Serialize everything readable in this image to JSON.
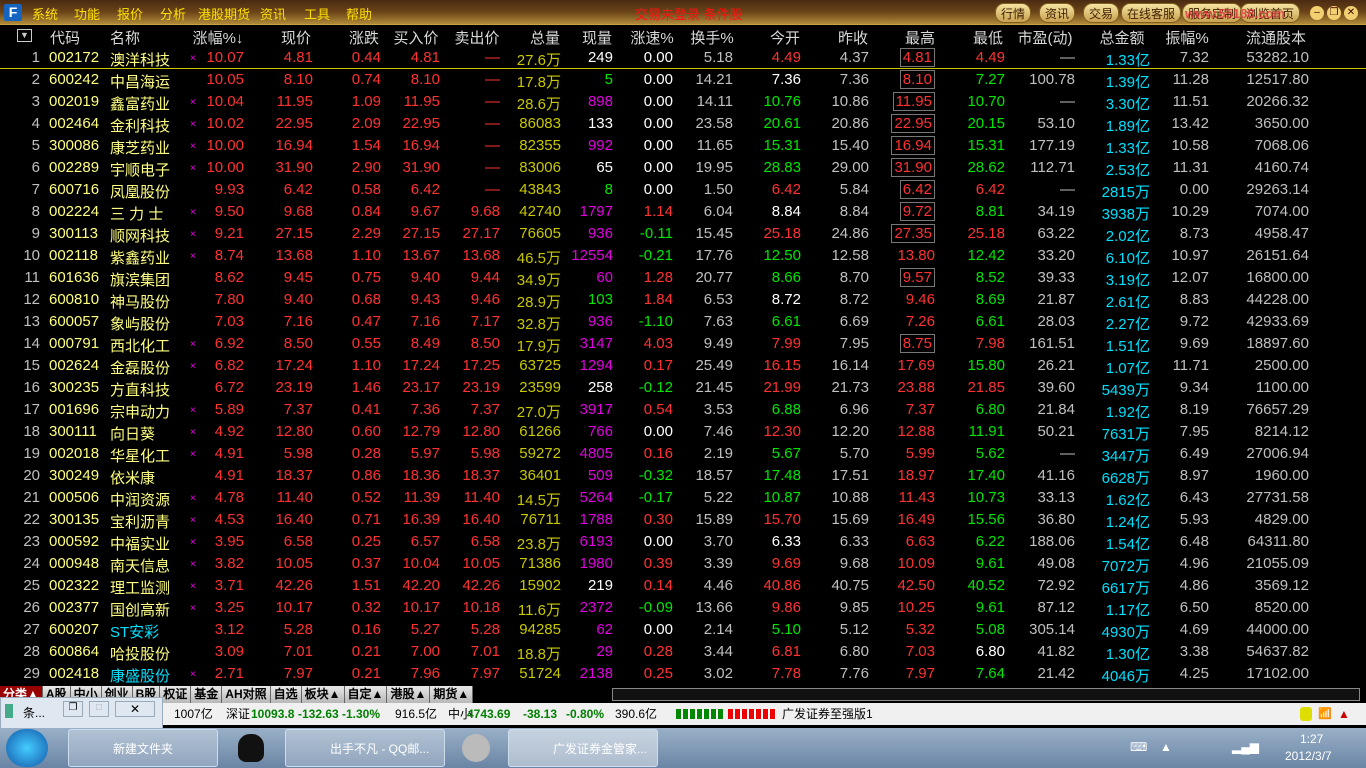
{
  "menubar": {
    "logo": "F",
    "items": [
      "系统",
      "功能",
      "报价",
      "分析",
      "港股期货",
      "资讯",
      "工具",
      "帮助"
    ],
    "title": "交易未登录 条件股",
    "buttons": [
      "行情",
      "资讯",
      "交易",
      "在线客服",
      "服务定制",
      "浏览首页"
    ],
    "watermark": "www.55188.com"
  },
  "header": {
    "sort_icon": "▼",
    "columns": [
      "代码",
      "名称",
      "涨幅%↓",
      "现价",
      "涨跌",
      "买入价",
      "卖出价",
      "总量",
      "现量",
      "涨速%",
      "换手%",
      "今开",
      "昨收",
      "最高",
      "最低",
      "市盈(动)",
      "总金额",
      "振幅%",
      "流通股本"
    ]
  },
  "colors": {
    "up": "#ff3232",
    "down": "#00e600",
    "volume": "#c8c800",
    "amount": "#00e0ff",
    "code": "#ffff80",
    "sell_tick": "#e000e0"
  },
  "rows": [
    {
      "v": [
        "1",
        "002172",
        "澳洋科技",
        "×",
        "10.07",
        "4.81",
        "0.44",
        "4.81",
        "—",
        "27.6万",
        "249",
        "0.00",
        "5.18",
        "4.49",
        "4.37",
        "4.81",
        "4.49",
        "—",
        "1.33亿",
        "7.32",
        "53282.10"
      ],
      "cur": "w",
      "box": true
    },
    {
      "v": [
        "2",
        "600242",
        "中昌海运",
        "",
        "10.05",
        "8.10",
        "0.74",
        "8.10",
        "—",
        "17.8万",
        "5",
        "0.00",
        "14.21",
        "7.36",
        "7.36",
        "8.10",
        "7.27",
        "100.78",
        "1.39亿",
        "11.28",
        "12517.80"
      ],
      "cur": "g",
      "box": true
    },
    {
      "v": [
        "3",
        "002019",
        "鑫富药业",
        "×",
        "10.04",
        "11.95",
        "1.09",
        "11.95",
        "—",
        "28.6万",
        "898",
        "0.00",
        "14.11",
        "10.76",
        "10.86",
        "11.95",
        "10.70",
        "—",
        "3.30亿",
        "11.51",
        "20266.32"
      ],
      "cur": "m",
      "box": true
    },
    {
      "v": [
        "4",
        "002464",
        "金利科技",
        "×",
        "10.02",
        "22.95",
        "2.09",
        "22.95",
        "—",
        "86083",
        "133",
        "0.00",
        "23.58",
        "20.61",
        "20.86",
        "22.95",
        "20.15",
        "53.10",
        "1.89亿",
        "13.42",
        "3650.00"
      ],
      "cur": "w",
      "box": true
    },
    {
      "v": [
        "5",
        "300086",
        "康芝药业",
        "×",
        "10.00",
        "16.94",
        "1.54",
        "16.94",
        "—",
        "82355",
        "992",
        "0.00",
        "11.65",
        "15.31",
        "15.40",
        "16.94",
        "15.31",
        "177.19",
        "1.33亿",
        "10.58",
        "7068.06"
      ],
      "cur": "m",
      "box": true
    },
    {
      "v": [
        "6",
        "002289",
        "宇顺电子",
        "×",
        "10.00",
        "31.90",
        "2.90",
        "31.90",
        "—",
        "83006",
        "65",
        "0.00",
        "19.95",
        "28.83",
        "29.00",
        "31.90",
        "28.62",
        "112.71",
        "2.53亿",
        "11.31",
        "4160.74"
      ],
      "cur": "w",
      "box": true
    },
    {
      "v": [
        "7",
        "600716",
        "凤凰股份",
        "",
        "9.93",
        "6.42",
        "0.58",
        "6.42",
        "—",
        "43843",
        "8",
        "0.00",
        "1.50",
        "6.42",
        "5.84",
        "6.42",
        "6.42",
        "—",
        "2815万",
        "0.00",
        "29263.14"
      ],
      "cur": "g",
      "box": true
    },
    {
      "v": [
        "8",
        "002224",
        "三 力 士",
        "×",
        "9.50",
        "9.68",
        "0.84",
        "9.67",
        "9.68",
        "42740",
        "1797",
        "1.14",
        "6.04",
        "8.84",
        "8.84",
        "9.72",
        "8.81",
        "34.19",
        "3938万",
        "10.29",
        "7074.00"
      ],
      "cur": "m",
      "box": true
    },
    {
      "v": [
        "9",
        "300113",
        "顺网科技",
        "×",
        "9.21",
        "27.15",
        "2.29",
        "27.15",
        "27.17",
        "76605",
        "936",
        "-0.11",
        "15.45",
        "25.18",
        "24.86",
        "27.35",
        "25.18",
        "63.22",
        "2.02亿",
        "8.73",
        "4958.47"
      ],
      "cur": "m",
      "box": true
    },
    {
      "v": [
        "10",
        "002118",
        "紫鑫药业",
        "×",
        "8.74",
        "13.68",
        "1.10",
        "13.67",
        "13.68",
        "46.5万",
        "12554",
        "-0.21",
        "17.76",
        "12.50",
        "12.58",
        "13.80",
        "12.42",
        "33.20",
        "6.10亿",
        "10.97",
        "26151.64"
      ],
      "cur": "m",
      "box": false
    },
    {
      "v": [
        "11",
        "601636",
        "旗滨集团",
        "",
        "8.62",
        "9.45",
        "0.75",
        "9.40",
        "9.44",
        "34.9万",
        "60",
        "1.28",
        "20.77",
        "8.66",
        "8.70",
        "9.57",
        "8.52",
        "39.33",
        "3.19亿",
        "12.07",
        "16800.00"
      ],
      "cur": "m",
      "box": true
    },
    {
      "v": [
        "12",
        "600810",
        "神马股份",
        "",
        "7.80",
        "9.40",
        "0.68",
        "9.43",
        "9.46",
        "28.9万",
        "103",
        "1.84",
        "6.53",
        "8.72",
        "8.72",
        "9.46",
        "8.69",
        "21.87",
        "2.61亿",
        "8.83",
        "44228.00"
      ],
      "cur": "g",
      "box": false
    },
    {
      "v": [
        "13",
        "600057",
        "象屿股份",
        "",
        "7.03",
        "7.16",
        "0.47",
        "7.16",
        "7.17",
        "32.8万",
        "936",
        "-1.10",
        "7.63",
        "6.61",
        "6.69",
        "7.26",
        "6.61",
        "28.03",
        "2.27亿",
        "9.72",
        "42933.69"
      ],
      "cur": "m",
      "box": false
    },
    {
      "v": [
        "14",
        "000791",
        "西北化工",
        "×",
        "6.92",
        "8.50",
        "0.55",
        "8.49",
        "8.50",
        "17.9万",
        "3147",
        "4.03",
        "9.49",
        "7.99",
        "7.95",
        "8.75",
        "7.98",
        "161.51",
        "1.51亿",
        "9.69",
        "18897.60"
      ],
      "cur": "m",
      "box": true
    },
    {
      "v": [
        "15",
        "002624",
        "金磊股份",
        "×",
        "6.82",
        "17.24",
        "1.10",
        "17.24",
        "17.25",
        "63725",
        "1294",
        "0.17",
        "25.49",
        "16.15",
        "16.14",
        "17.69",
        "15.80",
        "26.21",
        "1.07亿",
        "11.71",
        "2500.00"
      ],
      "cur": "m",
      "box": false
    },
    {
      "v": [
        "16",
        "300235",
        "方直科技",
        "",
        "6.72",
        "23.19",
        "1.46",
        "23.17",
        "23.19",
        "23599",
        "258",
        "-0.12",
        "21.45",
        "21.99",
        "21.73",
        "23.88",
        "21.85",
        "39.60",
        "5439万",
        "9.34",
        "1100.00"
      ],
      "cur": "w",
      "box": false
    },
    {
      "v": [
        "17",
        "001696",
        "宗申动力",
        "×",
        "5.89",
        "7.37",
        "0.41",
        "7.36",
        "7.37",
        "27.0万",
        "3917",
        "0.54",
        "3.53",
        "6.88",
        "6.96",
        "7.37",
        "6.80",
        "21.84",
        "1.92亿",
        "8.19",
        "76657.29"
      ],
      "cur": "m",
      "box": false
    },
    {
      "v": [
        "18",
        "300111",
        "向日葵",
        "×",
        "4.92",
        "12.80",
        "0.60",
        "12.79",
        "12.80",
        "61266",
        "766",
        "0.00",
        "7.46",
        "12.30",
        "12.20",
        "12.88",
        "11.91",
        "50.21",
        "7631万",
        "7.95",
        "8214.12"
      ],
      "cur": "m",
      "box": false
    },
    {
      "v": [
        "19",
        "002018",
        "华星化工",
        "×",
        "4.91",
        "5.98",
        "0.28",
        "5.97",
        "5.98",
        "59272",
        "4805",
        "0.16",
        "2.19",
        "5.67",
        "5.70",
        "5.99",
        "5.62",
        "—",
        "3447万",
        "6.49",
        "27006.94"
      ],
      "cur": "m",
      "box": false
    },
    {
      "v": [
        "20",
        "300249",
        "依米康",
        "",
        "4.91",
        "18.37",
        "0.86",
        "18.36",
        "18.37",
        "36401",
        "509",
        "-0.32",
        "18.57",
        "17.48",
        "17.51",
        "18.97",
        "17.40",
        "41.16",
        "6628万",
        "8.97",
        "1960.00"
      ],
      "cur": "m",
      "box": false
    },
    {
      "v": [
        "21",
        "000506",
        "中润资源",
        "×",
        "4.78",
        "11.40",
        "0.52",
        "11.39",
        "11.40",
        "14.5万",
        "5264",
        "-0.17",
        "5.22",
        "10.87",
        "10.88",
        "11.43",
        "10.73",
        "33.13",
        "1.62亿",
        "6.43",
        "27731.58"
      ],
      "cur": "m",
      "box": false
    },
    {
      "v": [
        "22",
        "300135",
        "宝利沥青",
        "×",
        "4.53",
        "16.40",
        "0.71",
        "16.39",
        "16.40",
        "76711",
        "1788",
        "0.30",
        "15.89",
        "15.70",
        "15.69",
        "16.49",
        "15.56",
        "36.80",
        "1.24亿",
        "5.93",
        "4829.00"
      ],
      "cur": "m",
      "box": false
    },
    {
      "v": [
        "23",
        "000592",
        "中福实业",
        "×",
        "3.95",
        "6.58",
        "0.25",
        "6.57",
        "6.58",
        "23.8万",
        "6193",
        "0.00",
        "3.70",
        "6.33",
        "6.33",
        "6.63",
        "6.22",
        "188.06",
        "1.54亿",
        "6.48",
        "64311.80"
      ],
      "cur": "m",
      "box": false
    },
    {
      "v": [
        "24",
        "000948",
        "南天信息",
        "×",
        "3.82",
        "10.05",
        "0.37",
        "10.04",
        "10.05",
        "71386",
        "1980",
        "0.39",
        "3.39",
        "9.69",
        "9.68",
        "10.09",
        "9.61",
        "49.08",
        "7072万",
        "4.96",
        "21055.09"
      ],
      "cur": "m",
      "box": false
    },
    {
      "v": [
        "25",
        "002322",
        "理工监测",
        "×",
        "3.71",
        "42.26",
        "1.51",
        "42.20",
        "42.26",
        "15902",
        "219",
        "0.14",
        "4.46",
        "40.86",
        "40.75",
        "42.50",
        "40.52",
        "72.92",
        "6617万",
        "4.86",
        "3569.12"
      ],
      "cur": "w",
      "box": false
    },
    {
      "v": [
        "26",
        "002377",
        "国创高新",
        "×",
        "3.25",
        "10.17",
        "0.32",
        "10.17",
        "10.18",
        "11.6万",
        "2372",
        "-0.09",
        "13.66",
        "9.86",
        "9.85",
        "10.25",
        "9.61",
        "87.12",
        "1.17亿",
        "6.50",
        "8520.00"
      ],
      "cur": "m",
      "box": false
    },
    {
      "v": [
        "27",
        "600207",
        "ST安彩",
        "",
        "3.12",
        "5.28",
        "0.16",
        "5.27",
        "5.28",
        "94285",
        "62",
        "0.00",
        "2.14",
        "5.10",
        "5.12",
        "5.32",
        "5.08",
        "305.14",
        "4930万",
        "4.69",
        "44000.00"
      ],
      "cur": "m",
      "box": false,
      "name_color": "cy"
    },
    {
      "v": [
        "28",
        "600864",
        "哈投股份",
        "",
        "3.09",
        "7.01",
        "0.21",
        "7.00",
        "7.01",
        "18.8万",
        "29",
        "0.28",
        "3.44",
        "6.81",
        "6.80",
        "7.03",
        "6.80",
        "41.82",
        "1.30亿",
        "3.38",
        "54637.82"
      ],
      "cur": "m",
      "box": false
    },
    {
      "v": [
        "29",
        "002418",
        "康盛股份",
        "×",
        "2.71",
        "7.97",
        "0.21",
        "7.96",
        "7.97",
        "51724",
        "2138",
        "0.25",
        "3.02",
        "7.78",
        "7.76",
        "7.97",
        "7.64",
        "21.42",
        "4046万",
        "4.25",
        "17102.00"
      ],
      "cur": "m",
      "box": false,
      "name_color": "cy"
    }
  ],
  "tabs": [
    "分类▲",
    "A股",
    "中小",
    "创业",
    "B股",
    "权证",
    "基金",
    "AH对照",
    "自选",
    "板块▲",
    "自定▲",
    "港股▲",
    "期货▲"
  ],
  "status": {
    "sh_amount": "1007亿",
    "sz_label": "深证",
    "sz_index": "10093.8",
    "sz_change": "-132.63",
    "sz_pct": "-1.30%",
    "sz_amount": "916.5亿",
    "zx_label": "中小",
    "zx_index": "4743.69",
    "zx_change": "-38.13",
    "zx_pct": "-0.80%",
    "zx_amount": "390.6亿",
    "server": "广发证券至强版1"
  },
  "float_window": {
    "label": "条..."
  },
  "taskbar": {
    "items": [
      "新建文件夹",
      "出手不凡 - QQ邮...",
      "广发证券金管家..."
    ],
    "time": "1:27",
    "date": "2012/3/7"
  }
}
